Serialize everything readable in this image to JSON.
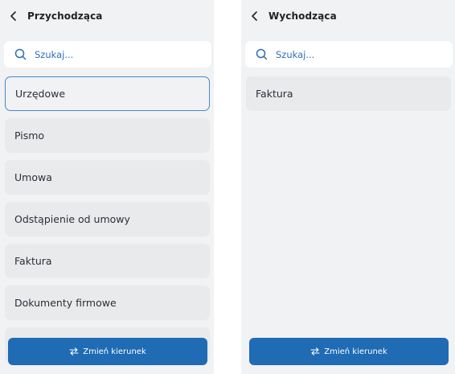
{
  "left": {
    "title": "Przychodząca",
    "search_placeholder": "Szukaj...",
    "items": [
      {
        "label": "Urzędowe",
        "selected": true
      },
      {
        "label": "Pismo"
      },
      {
        "label": "Umowa"
      },
      {
        "label": "Odstąpienie od umowy"
      },
      {
        "label": "Faktura"
      },
      {
        "label": "Dokumenty firmowe"
      },
      {
        "label": ""
      }
    ],
    "button_label": "Zmień kierunek"
  },
  "right": {
    "title": "Wychodząca",
    "search_placeholder": "Szukaj...",
    "items": [
      {
        "label": "Faktura"
      }
    ],
    "button_label": "Zmień kierunek"
  },
  "icons": {
    "back": "chevron-left-icon",
    "search": "search-icon",
    "switch": "swap-arrows-icon"
  },
  "colors": {
    "accent": "#1f6bb4",
    "search_text": "#2f6fb5",
    "selected_border": "#4a86c8",
    "background": "#f1f2f4",
    "item_background": "#e9eaec"
  }
}
